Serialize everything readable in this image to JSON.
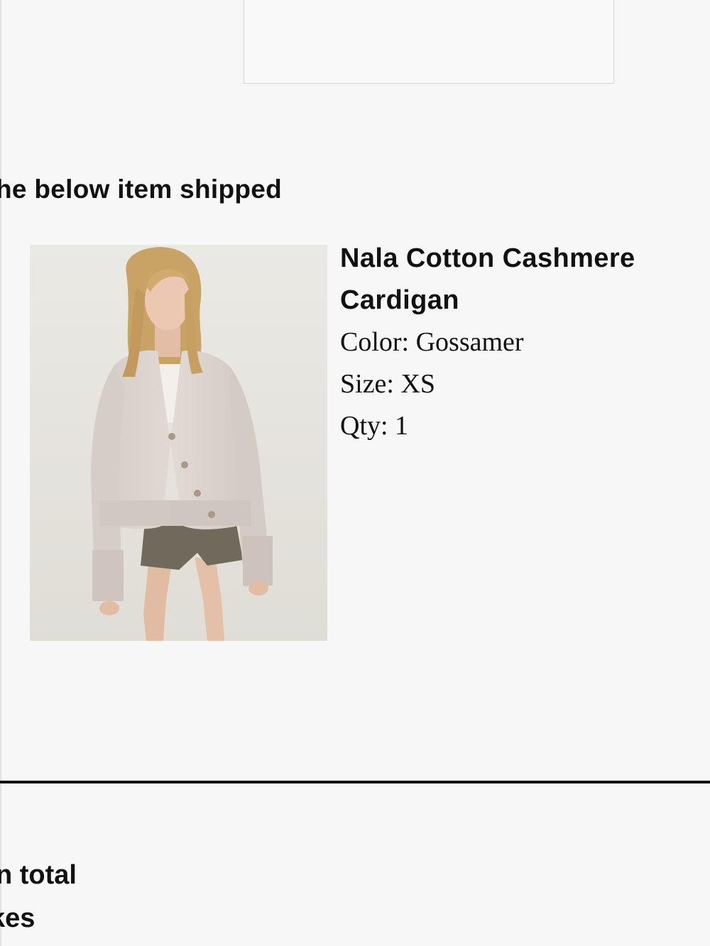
{
  "shipment": {
    "heading": "he below item shipped"
  },
  "product": {
    "name": "Nala Cotton Cashmere Cardigan",
    "color": "Color: Gossamer",
    "size": "Size: XS",
    "qty": "Qty: 1",
    "image_colors": {
      "backdrop": "#e9e7e2",
      "cardigan": "#dcd2cc",
      "shorts": "#6f6a5c",
      "hair": "#c9a266",
      "skin": "#e8c3ad"
    }
  },
  "summary": {
    "item_total": "n total",
    "taxes": "kes"
  }
}
